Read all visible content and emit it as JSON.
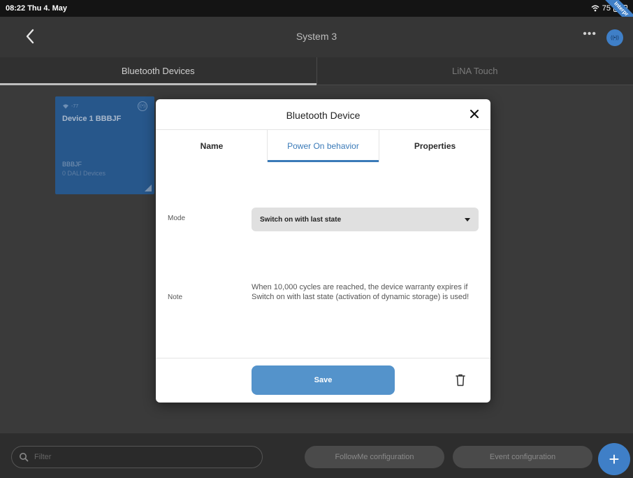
{
  "status": {
    "time": "08:22",
    "date": "Thu 4. May",
    "battery": "75",
    "ribbon": "Interpr"
  },
  "navbar": {
    "title": "System 3",
    "more": "•••",
    "radio_glyph": "((•))"
  },
  "tabs": [
    {
      "label": "Bluetooth Devices",
      "active": true
    },
    {
      "label": "LiNA Touch",
      "active": false
    }
  ],
  "device_card": {
    "signal_text": "-77",
    "title": "Device 1 BBBJF",
    "subtitle": "BBBJF",
    "dali_count": "0 DALI Devices",
    "radio_glyph": "((•))"
  },
  "modal": {
    "title": "Bluetooth Device",
    "tabs": [
      {
        "label": "Name"
      },
      {
        "label": "Power On behavior",
        "active": true
      },
      {
        "label": "Properties"
      }
    ],
    "mode_label": "Mode",
    "mode_value": "Switch on with last state",
    "note_label": "Note",
    "note_text": "When 10,000 cycles are reached, the device warranty expires if Switch on with last state (activation of dynamic storage) is used!",
    "save_label": "Save"
  },
  "bottom": {
    "filter_placeholder": "Filter",
    "followme_label": "FollowMe configuration",
    "event_label": "Event configuration",
    "fab_label": "+"
  },
  "colors": {
    "accent": "#3f7fc7",
    "save_button": "#5493cb",
    "card": "#27578b"
  }
}
